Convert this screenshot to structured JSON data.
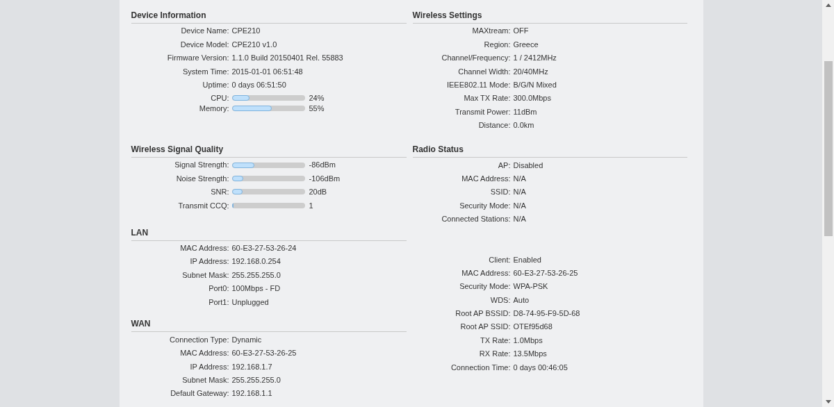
{
  "left_column": [
    {
      "title": "Device Information",
      "rows": [
        {
          "kind": "text",
          "label": "Device Name:",
          "value": "CPE210"
        },
        {
          "kind": "text",
          "label": "Device Model:",
          "value": "CPE210 v1.0"
        },
        {
          "kind": "text",
          "label": "Firmware Version:",
          "value": "1.1.0 Build 20150401 Rel. 55883"
        },
        {
          "kind": "text",
          "label": "System Time:",
          "value": "2015-01-01 06:51:48"
        },
        {
          "kind": "text",
          "label": "Uptime:",
          "value": "0 days 06:51:50"
        },
        {
          "kind": "meter",
          "label": "CPU:",
          "value": "24%",
          "level": 0.24
        },
        {
          "kind": "meter",
          "label": "Memory:",
          "value": "55%",
          "level": 0.55
        }
      ]
    },
    {
      "title": "Wireless Signal Quality",
      "rows": [
        {
          "kind": "meter",
          "label": "Signal Strength:",
          "value": "-86dBm",
          "level": 0.31
        },
        {
          "kind": "meter",
          "label": "Noise Strength:",
          "value": "-106dBm",
          "level": 0.16
        },
        {
          "kind": "meter",
          "label": "SNR:",
          "value": "20dB",
          "level": 0.15
        },
        {
          "kind": "meter",
          "label": "Transmit CCQ:",
          "value": "1",
          "level": 0.01
        }
      ]
    },
    {
      "title": "LAN",
      "rows": [
        {
          "kind": "text",
          "label": "MAC Address:",
          "value": "60-E3-27-53-26-24"
        },
        {
          "kind": "text",
          "label": "IP Address:",
          "value": "192.168.0.254"
        },
        {
          "kind": "text",
          "label": "Subnet Mask:",
          "value": "255.255.255.0"
        },
        {
          "kind": "text",
          "label": "Port0:",
          "value": "100Mbps - FD"
        },
        {
          "kind": "text",
          "label": "Port1:",
          "value": "Unplugged"
        }
      ]
    },
    {
      "title": "WAN",
      "rows": [
        {
          "kind": "text",
          "label": "Connection Type:",
          "value": "Dynamic"
        },
        {
          "kind": "text",
          "label": "MAC Address:",
          "value": "60-E3-27-53-26-25"
        },
        {
          "kind": "text",
          "label": "IP Address:",
          "value": "192.168.1.7"
        },
        {
          "kind": "text",
          "label": "Subnet Mask:",
          "value": "255.255.255.0"
        },
        {
          "kind": "text",
          "label": "Default Gateway:",
          "value": "192.168.1.1"
        }
      ]
    }
  ],
  "right_column": [
    {
      "title": "Wireless Settings",
      "rows": [
        {
          "kind": "text",
          "label": "MAXtream:",
          "value": "OFF"
        },
        {
          "kind": "text",
          "label": "Region:",
          "value": "Greece"
        },
        {
          "kind": "text",
          "label": "Channel/Frequency:",
          "value": "1 / 2412MHz"
        },
        {
          "kind": "text",
          "label": "Channel Width:",
          "value": "20/40MHz"
        },
        {
          "kind": "text",
          "label": "IEEE802.11 Mode:",
          "value": "B/G/N Mixed"
        },
        {
          "kind": "text",
          "label": "Max TX Rate:",
          "value": "300.0Mbps"
        },
        {
          "kind": "text",
          "label": "Transmit Power:",
          "value": "11dBm"
        },
        {
          "kind": "text",
          "label": "Distance:",
          "value": "0.0km"
        }
      ]
    },
    {
      "title": "Radio Status",
      "rows": [
        {
          "kind": "text",
          "label": "AP:",
          "value": "Disabled"
        },
        {
          "kind": "text",
          "label": "MAC Address:",
          "value": "N/A"
        },
        {
          "kind": "text",
          "label": "SSID:",
          "value": "N/A"
        },
        {
          "kind": "text",
          "label": "Security Mode:",
          "value": "N/A"
        },
        {
          "kind": "text",
          "label": "Connected Stations:",
          "value": "N/A"
        }
      ]
    },
    {
      "rows": [
        {
          "kind": "text",
          "label": "Client:",
          "value": "Enabled"
        },
        {
          "kind": "text",
          "label": "MAC Address:",
          "value": "60-E3-27-53-26-25"
        },
        {
          "kind": "text",
          "label": "Security Mode:",
          "value": "WPA-PSK"
        },
        {
          "kind": "text",
          "label": "WDS:",
          "value": "Auto"
        },
        {
          "kind": "text",
          "label": "Root AP BSSID:",
          "value": "D8-74-95-F9-5D-68"
        },
        {
          "kind": "text",
          "label": "Root AP SSID:",
          "value": "OTEf95d68"
        },
        {
          "kind": "text",
          "label": "TX Rate:",
          "value": "1.0Mbps"
        },
        {
          "kind": "text",
          "label": "RX Rate:",
          "value": "13.5Mbps"
        },
        {
          "kind": "text",
          "label": "Connection Time:",
          "value": "0 days 00:46:05"
        }
      ]
    }
  ]
}
